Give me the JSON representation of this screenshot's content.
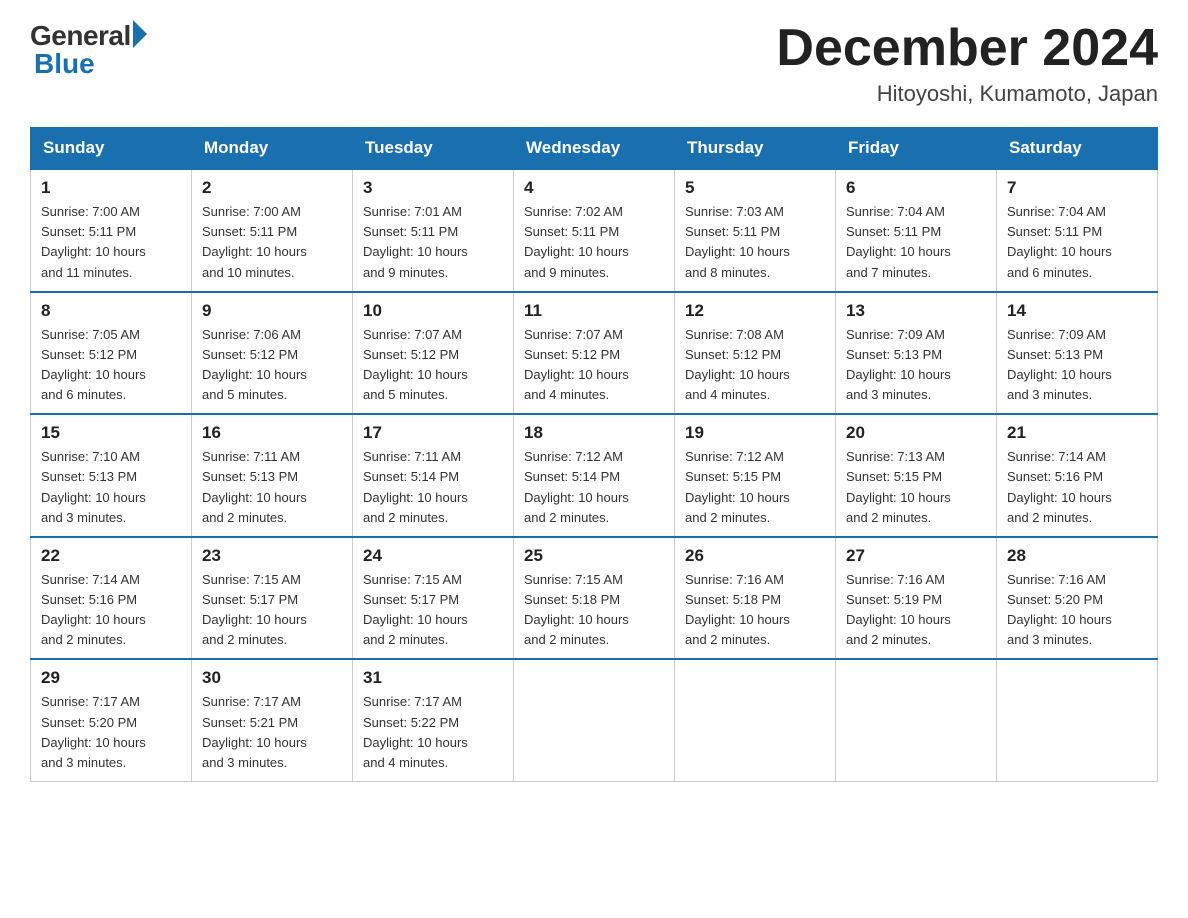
{
  "logo": {
    "general": "General",
    "blue": "Blue"
  },
  "title": "December 2024",
  "location": "Hitoyoshi, Kumamoto, Japan",
  "days_of_week": [
    "Sunday",
    "Monday",
    "Tuesday",
    "Wednesday",
    "Thursday",
    "Friday",
    "Saturday"
  ],
  "weeks": [
    [
      {
        "day": "1",
        "sunrise": "7:00 AM",
        "sunset": "5:11 PM",
        "daylight": "10 hours and 11 minutes."
      },
      {
        "day": "2",
        "sunrise": "7:00 AM",
        "sunset": "5:11 PM",
        "daylight": "10 hours and 10 minutes."
      },
      {
        "day": "3",
        "sunrise": "7:01 AM",
        "sunset": "5:11 PM",
        "daylight": "10 hours and 9 minutes."
      },
      {
        "day": "4",
        "sunrise": "7:02 AM",
        "sunset": "5:11 PM",
        "daylight": "10 hours and 9 minutes."
      },
      {
        "day": "5",
        "sunrise": "7:03 AM",
        "sunset": "5:11 PM",
        "daylight": "10 hours and 8 minutes."
      },
      {
        "day": "6",
        "sunrise": "7:04 AM",
        "sunset": "5:11 PM",
        "daylight": "10 hours and 7 minutes."
      },
      {
        "day": "7",
        "sunrise": "7:04 AM",
        "sunset": "5:11 PM",
        "daylight": "10 hours and 6 minutes."
      }
    ],
    [
      {
        "day": "8",
        "sunrise": "7:05 AM",
        "sunset": "5:12 PM",
        "daylight": "10 hours and 6 minutes."
      },
      {
        "day": "9",
        "sunrise": "7:06 AM",
        "sunset": "5:12 PM",
        "daylight": "10 hours and 5 minutes."
      },
      {
        "day": "10",
        "sunrise": "7:07 AM",
        "sunset": "5:12 PM",
        "daylight": "10 hours and 5 minutes."
      },
      {
        "day": "11",
        "sunrise": "7:07 AM",
        "sunset": "5:12 PM",
        "daylight": "10 hours and 4 minutes."
      },
      {
        "day": "12",
        "sunrise": "7:08 AM",
        "sunset": "5:12 PM",
        "daylight": "10 hours and 4 minutes."
      },
      {
        "day": "13",
        "sunrise": "7:09 AM",
        "sunset": "5:13 PM",
        "daylight": "10 hours and 3 minutes."
      },
      {
        "day": "14",
        "sunrise": "7:09 AM",
        "sunset": "5:13 PM",
        "daylight": "10 hours and 3 minutes."
      }
    ],
    [
      {
        "day": "15",
        "sunrise": "7:10 AM",
        "sunset": "5:13 PM",
        "daylight": "10 hours and 3 minutes."
      },
      {
        "day": "16",
        "sunrise": "7:11 AM",
        "sunset": "5:13 PM",
        "daylight": "10 hours and 2 minutes."
      },
      {
        "day": "17",
        "sunrise": "7:11 AM",
        "sunset": "5:14 PM",
        "daylight": "10 hours and 2 minutes."
      },
      {
        "day": "18",
        "sunrise": "7:12 AM",
        "sunset": "5:14 PM",
        "daylight": "10 hours and 2 minutes."
      },
      {
        "day": "19",
        "sunrise": "7:12 AM",
        "sunset": "5:15 PM",
        "daylight": "10 hours and 2 minutes."
      },
      {
        "day": "20",
        "sunrise": "7:13 AM",
        "sunset": "5:15 PM",
        "daylight": "10 hours and 2 minutes."
      },
      {
        "day": "21",
        "sunrise": "7:14 AM",
        "sunset": "5:16 PM",
        "daylight": "10 hours and 2 minutes."
      }
    ],
    [
      {
        "day": "22",
        "sunrise": "7:14 AM",
        "sunset": "5:16 PM",
        "daylight": "10 hours and 2 minutes."
      },
      {
        "day": "23",
        "sunrise": "7:15 AM",
        "sunset": "5:17 PM",
        "daylight": "10 hours and 2 minutes."
      },
      {
        "day": "24",
        "sunrise": "7:15 AM",
        "sunset": "5:17 PM",
        "daylight": "10 hours and 2 minutes."
      },
      {
        "day": "25",
        "sunrise": "7:15 AM",
        "sunset": "5:18 PM",
        "daylight": "10 hours and 2 minutes."
      },
      {
        "day": "26",
        "sunrise": "7:16 AM",
        "sunset": "5:18 PM",
        "daylight": "10 hours and 2 minutes."
      },
      {
        "day": "27",
        "sunrise": "7:16 AM",
        "sunset": "5:19 PM",
        "daylight": "10 hours and 2 minutes."
      },
      {
        "day": "28",
        "sunrise": "7:16 AM",
        "sunset": "5:20 PM",
        "daylight": "10 hours and 3 minutes."
      }
    ],
    [
      {
        "day": "29",
        "sunrise": "7:17 AM",
        "sunset": "5:20 PM",
        "daylight": "10 hours and 3 minutes."
      },
      {
        "day": "30",
        "sunrise": "7:17 AM",
        "sunset": "5:21 PM",
        "daylight": "10 hours and 3 minutes."
      },
      {
        "day": "31",
        "sunrise": "7:17 AM",
        "sunset": "5:22 PM",
        "daylight": "10 hours and 4 minutes."
      },
      null,
      null,
      null,
      null
    ]
  ]
}
